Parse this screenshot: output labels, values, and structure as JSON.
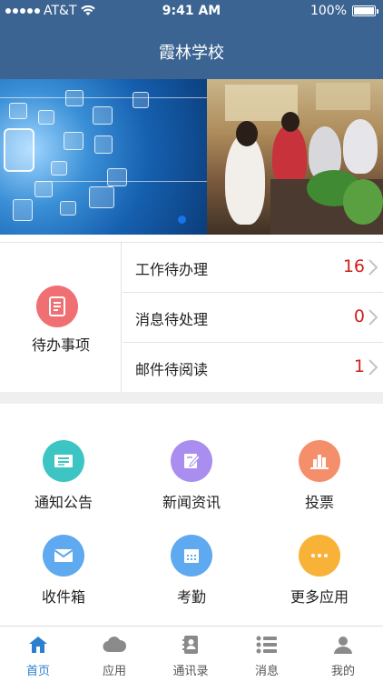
{
  "status_bar": {
    "carrier": "AT&T",
    "time": "9:41 AM",
    "battery": "100%"
  },
  "header": {
    "title": "霞林学校"
  },
  "banner": {
    "pager_active": 0
  },
  "todo": {
    "title": "待办事项",
    "items": [
      {
        "label": "工作待办理",
        "count": "16"
      },
      {
        "label": "消息待处理",
        "count": "0"
      },
      {
        "label": "邮件待阅读",
        "count": "1"
      }
    ]
  },
  "apps": [
    {
      "name": "通知公告",
      "color": "#3cc5c2",
      "icon": "notice-icon"
    },
    {
      "name": "新闻资讯",
      "color": "#a98ef0",
      "icon": "news-icon"
    },
    {
      "name": "投票",
      "color": "#f58f6b",
      "icon": "vote-chart-icon"
    },
    {
      "name": "收件箱",
      "color": "#5ea9ef",
      "icon": "mail-icon"
    },
    {
      "name": "考勤",
      "color": "#5ea9ef",
      "icon": "calendar-icon"
    },
    {
      "name": "更多应用",
      "color": "#f8b238",
      "icon": "more-icon"
    }
  ],
  "tabbar": {
    "active": "home",
    "items": [
      {
        "label": "首页",
        "icon": "home-icon"
      },
      {
        "label": "应用",
        "icon": "cloud-icon"
      },
      {
        "label": "通讯录",
        "icon": "contacts-icon"
      },
      {
        "label": "消息",
        "icon": "list-icon"
      },
      {
        "label": "我的",
        "icon": "user-icon"
      }
    ]
  },
  "colors": {
    "header": "#3c6492",
    "accent": "#2b7fcf",
    "count": "#d0201c"
  }
}
